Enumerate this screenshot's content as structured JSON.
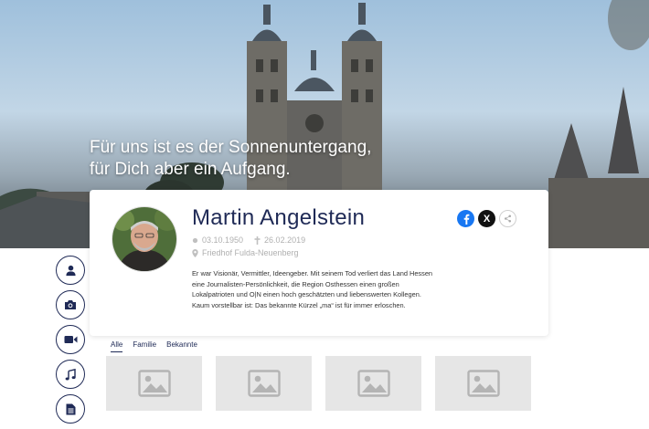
{
  "hero": {
    "quote_line1": "Für uns ist es der Sonnenuntergang,",
    "quote_line2": "für Dich aber ein Aufgang."
  },
  "profile": {
    "name": "Martin Angelstein",
    "birth_date": "03.10.1950",
    "death_date": "26.02.2019",
    "cemetery": "Friedhof Fulda-Neuenberg",
    "bio": "Er war Visionär, Vermittler, Ideengeber. Mit seinem Tod verliert das Land Hessen eine Journalisten-Persönlichkeit, die Region Osthessen einen großen Lokalpatrioten und O|N einen hoch geschätzten und liebenswerten Kollegen. Kaum vorstellbar ist: Das bekannte Kürzel „ma“ ist für immer erloschen."
  },
  "share": {
    "icons": [
      "facebook-icon",
      "x-icon",
      "share-icon"
    ],
    "x_glyph": "X",
    "colors": {
      "facebook": "#1877f2",
      "x": "#111111"
    }
  },
  "sidebar": {
    "icons": [
      "user-icon",
      "camera-icon",
      "video-icon",
      "music-icon",
      "document-icon"
    ]
  },
  "tabs": [
    {
      "label": "Alle",
      "active": true
    },
    {
      "label": "Familie",
      "active": false
    },
    {
      "label": "Bekannte",
      "active": false
    }
  ],
  "gallery": {
    "placeholder_icon": "image-placeholder-icon",
    "count": 4
  },
  "colors": {
    "accent": "#1f2a56",
    "muted_text": "#b0b0b0",
    "placeholder": "#e6e6e6"
  }
}
